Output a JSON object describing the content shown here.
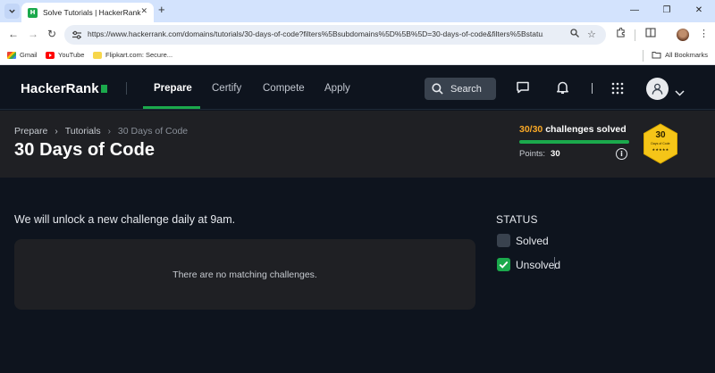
{
  "browser": {
    "tab_title": "Solve Tutorials | HackerRank",
    "url": "https://www.hackerrank.com/domains/tutorials/30-days-of-code?filters%5Bsubdomains%5D%5B%5D=30-days-of-code&filters%5Bstatu...",
    "bookmarks": [
      {
        "label": "Gmail",
        "icon": "gmail-icon"
      },
      {
        "label": "YouTube",
        "icon": "youtube-icon"
      },
      {
        "label": "Flipkart.com: Secure...",
        "icon": "flipkart-icon"
      }
    ],
    "all_bookmarks_label": "All Bookmarks"
  },
  "header": {
    "logo": "HackerRank",
    "nav": [
      {
        "label": "Prepare",
        "active": true
      },
      {
        "label": "Certify",
        "active": false
      },
      {
        "label": "Compete",
        "active": false
      },
      {
        "label": "Apply",
        "active": false
      }
    ],
    "search_label": "Search",
    "accent": "#1ba94c"
  },
  "page": {
    "breadcrumb": [
      "Prepare",
      "Tutorials",
      "30 Days of Code"
    ],
    "title": "30 Days of Code",
    "progress": {
      "fraction": "30/30",
      "label": "challenges solved",
      "percent": 100,
      "points_label": "Points:",
      "points": "30"
    },
    "badge": {
      "number": "30",
      "subtitle": "Days of Code",
      "stars": "★★★★★",
      "color": "#f5c518"
    }
  },
  "main": {
    "unlock_text": "We will unlock a new challenge daily at 9am.",
    "empty_text": "There are no matching challenges.",
    "status_heading": "STATUS",
    "filters": [
      {
        "label": "Solved",
        "checked": false
      },
      {
        "label": "Unsolved",
        "checked": true
      }
    ]
  }
}
